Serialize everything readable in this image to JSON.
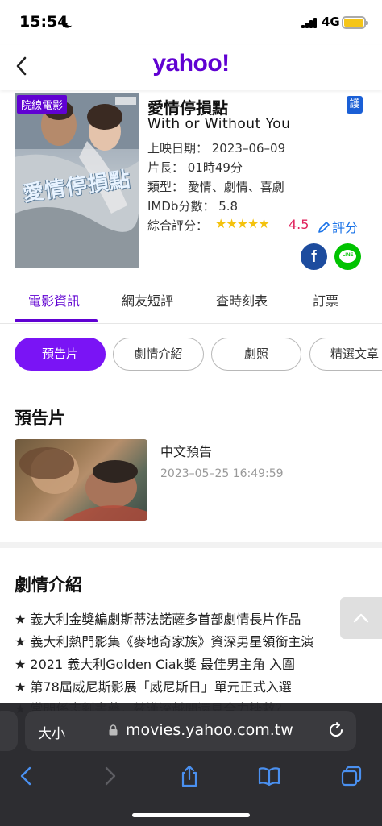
{
  "status_bar": {
    "time": "15:54",
    "network": "4G"
  },
  "header": {
    "logo": "yahoo!"
  },
  "movie": {
    "poster_badge": "院線電影",
    "poster_title": "愛情停損點",
    "title_zh": "愛情停損點",
    "title_en": "With or Without You",
    "protection_badge": "護",
    "release_date": "上映日期： 2023–06–09",
    "runtime": "片長： 01時49分",
    "genre": "類型： 愛情、劇情、喜劇",
    "imdb": "IMDb分數： 5.8",
    "rating_label": "綜合評分：",
    "rating_value": "4.5",
    "rating_stars": "★★★★★",
    "rate_button": "評分"
  },
  "share": {
    "facebook": "f",
    "line": "LINE"
  },
  "tabs": [
    "電影資訊",
    "網友短評",
    "查時刻表",
    "訂票"
  ],
  "pills": [
    "預告片",
    "劇情介紹",
    "劇照",
    "精選文章"
  ],
  "trailer_section": {
    "title": "預告片",
    "item_title": "中文預告",
    "item_date": "2023–05–25 16:49:59"
  },
  "plot_section": {
    "title": "劇情介紹",
    "lines": [
      "★ 義大利金獎編劇斯蒂法諾薩多首部劇情長片作品",
      "★ 義大利熱門影集《麥地奇家族》資深男星領銜主演",
      "★ 2021 義大利Golden Ciak獎 最佳男主角 入圍",
      "★ 第78屆威尼斯影展「威尼斯日」單元正式入選",
      "★ 常問係志劉書藥，兹漢深越開還見全力挫救？"
    ]
  },
  "browser": {
    "text_size": "大小",
    "url": "movies.yahoo.com.tw"
  },
  "colors": {
    "brand": "#6001d2",
    "accent": "#7a14f5",
    "star": "#f4c20d",
    "rating": "#e0245e",
    "link": "#1a73e8"
  }
}
